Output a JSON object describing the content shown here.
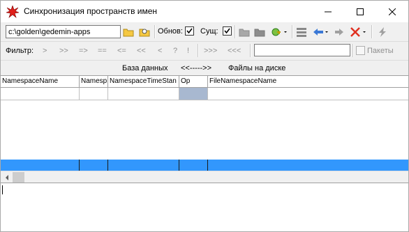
{
  "window": {
    "title": "Синхронизация пространств имен",
    "icon": "red-star-icon"
  },
  "toolbar": {
    "path_value": "c:\\golden\\gedemin-apps",
    "obnov_label": "Обнов:",
    "obnov_checked": true,
    "sush_label": "Сущ:",
    "sush_checked": true
  },
  "filter": {
    "label": "Фильтр:",
    "buttons": [
      ">",
      ">>",
      "=>",
      "==",
      "<=",
      "<<",
      "<",
      "?",
      "!",
      ">>>",
      "<<<"
    ],
    "packages_label": "Пакеты"
  },
  "captions": {
    "db": "База данных",
    "arrows": "<<----->>",
    "disk": "Файлы на диске"
  },
  "grid": {
    "columns": [
      "NamespaceName",
      "Namesp",
      "NamespaceTimeStan",
      "Op",
      "FileNamespaceName"
    ]
  }
}
